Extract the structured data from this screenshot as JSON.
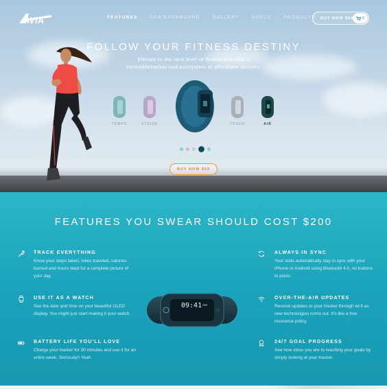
{
  "brand": {
    "name": "AVIA"
  },
  "nav": {
    "items": [
      {
        "label": "FEATURES",
        "active": true
      },
      {
        "label": "APP DASHBOARD",
        "active": false
      },
      {
        "label": "GALLERY",
        "active": false
      },
      {
        "label": "SPECS",
        "active": false
      },
      {
        "label": "PRODUCTS",
        "active": false
      }
    ],
    "buy_label": "BUY NOW $59",
    "cart_count": "0",
    "cart_icon": "cart-icon"
  },
  "hero": {
    "title": "FOLLOW YOUR FITNESS DESTINY",
    "subtitle_line1": "Elevate to the next level of fitness with Avia's",
    "subtitle_line2": "incredibletracker and ecosystem of affordable devices.",
    "trackers": [
      {
        "label": "TEMPO",
        "color": "#7fb7b9"
      },
      {
        "label": "STRIDE",
        "color": "#b7a6c9"
      },
      {
        "label": "",
        "color": "#1d5c77"
      },
      {
        "label": "TOUCH",
        "color": "#a9b1b8"
      },
      {
        "label": "AIR",
        "color": "#1c4a4a"
      }
    ],
    "carousel_dots": [
      "#7fd3d9",
      "#d6b8d1",
      "#c8ccd0",
      "#0e4656",
      "#7fd3d9"
    ],
    "buy_label": "BUY NOW $59",
    "accent": "#e89a3c"
  },
  "features": {
    "title": "FEATURES YOU SWEAR SHOULD COST $200",
    "device_time": "09:41",
    "device_time_suffix": "AM",
    "left": [
      {
        "icon": "trend-arrow-icon",
        "title": "TRACK EVERYTHING",
        "body": "Know your steps taken, miles traveled, calories burned and hours slept for a complete picture of your day."
      },
      {
        "icon": "watch-icon",
        "title": "USE IT AS A WATCH",
        "body": "See the date and time on your beautiful OLED display. You might just start making it your watch."
      },
      {
        "icon": "battery-icon",
        "title": "BATTERY LIFE YOU'LL LOVE",
        "body": "Charge your tracker for 30 minutes and use it for an entire week. Seriously!! Yeah."
      }
    ],
    "right": [
      {
        "icon": "sync-icon",
        "title": "ALWAYS IN SYNC",
        "body": "Your stats automatically stay in sync with your iPhone or Android using Bluetooth 4.0, no buttons to press."
      },
      {
        "icon": "wifi-icon",
        "title": "OVER-THE-AIR UPDATES",
        "body": "Receive updates to your tracker through wi-fi as new technologies come out. It's like a free insurance policy."
      },
      {
        "icon": "award-icon",
        "title": "24/7 GOAL PROGRESS",
        "body": "See how close you are to reaching your goals by simply looking at your tracker."
      }
    ],
    "bg_color": "#1ba3bb"
  }
}
